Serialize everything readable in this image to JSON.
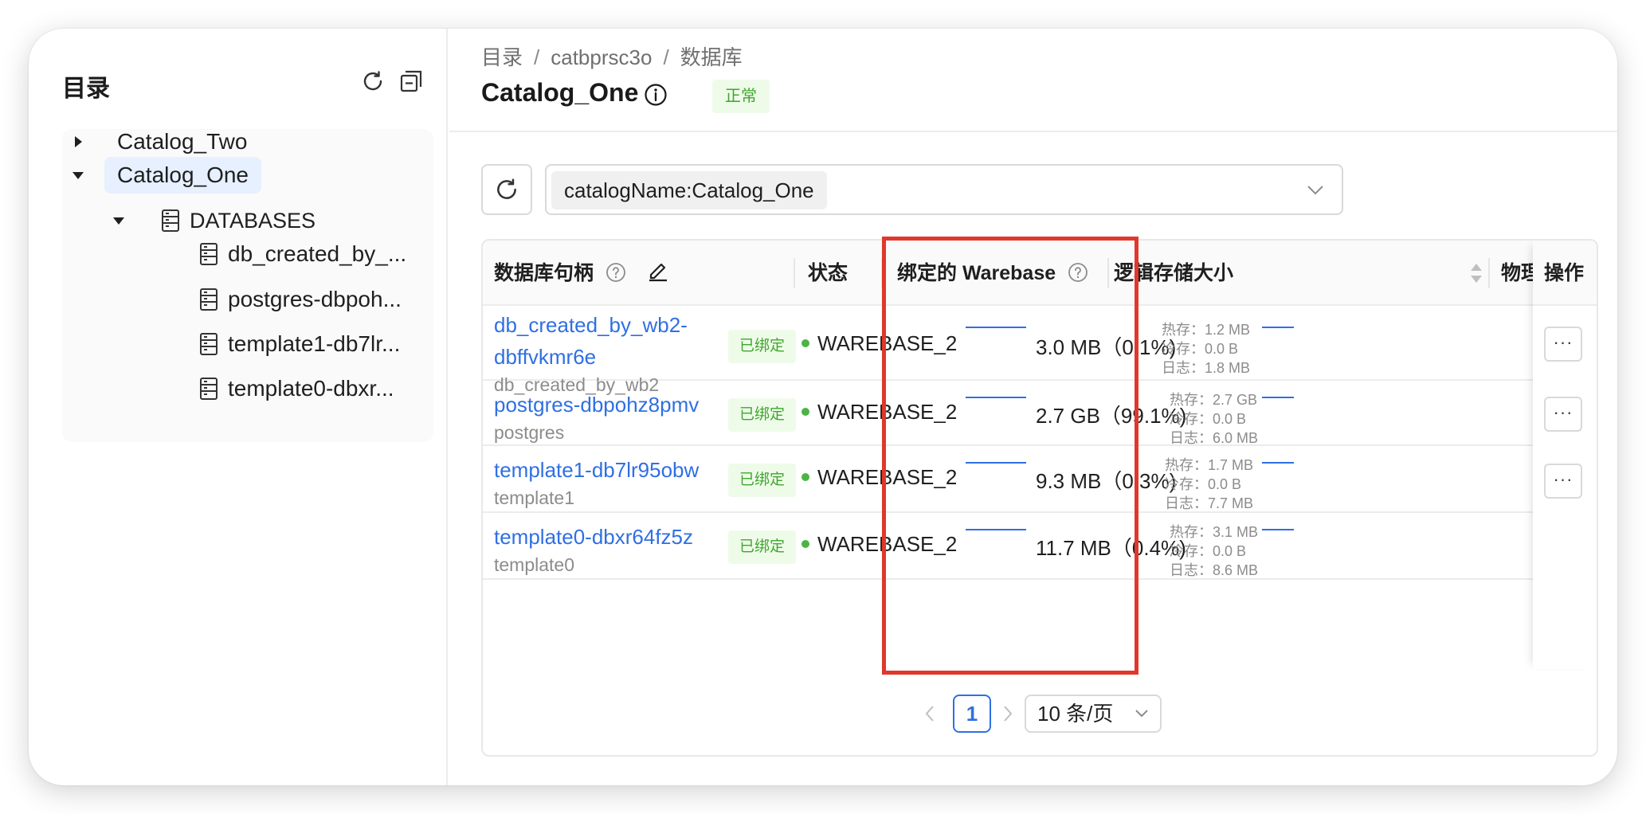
{
  "sidebar": {
    "title": "目录",
    "icons": {
      "refresh": "refresh-icon",
      "collapse": "collapse-all-icon"
    },
    "tree": [
      {
        "label": "Catalog_Two",
        "expanded": false
      },
      {
        "label": "Catalog_One",
        "expanded": true,
        "selected": true
      },
      {
        "label": "DATABASES",
        "expanded": true
      },
      {
        "label": "db_created_by_..."
      },
      {
        "label": "postgres-dbpoh..."
      },
      {
        "label": "template1-db7lr..."
      },
      {
        "label": "template0-dbxr..."
      }
    ]
  },
  "breadcrumb": {
    "items": [
      "目录",
      "catbprsc3o",
      "数据库"
    ],
    "separator": "/"
  },
  "header": {
    "title": "Catalog_One",
    "status": "正常"
  },
  "filter": {
    "tag": "catalogName:Catalog_One"
  },
  "table": {
    "columns": {
      "handle": "数据库句柄",
      "status": "状态",
      "warebase": "绑定的 Warebase",
      "logical_size": "逻辑存储大小",
      "physical": "物理",
      "actions": "操作"
    },
    "rows": [
      {
        "name_line1": "db_created_by_wb2-",
        "name_line2": "dbffvkmr6e",
        "sub": "db_created_by_wb2",
        "status": "已绑定",
        "warebase": "WAREBASE_2",
        "size": "3.0 MB（0.1%)",
        "hot": "热存：1.2 MB",
        "cold": "冷存：0.0 B",
        "log": "日志：1.8 MB",
        "more": "···"
      },
      {
        "name_line1": "postgres-dbpohz8pmv",
        "sub": "postgres",
        "status": "已绑定",
        "warebase": "WAREBASE_2",
        "size": "2.7 GB（99.1%)",
        "hot": "热存：2.7 GB",
        "cold": "冷存：0.0 B",
        "log": "日志：6.0 MB",
        "more": "···"
      },
      {
        "name_line1": "template1-db7lr95obw",
        "sub": "template1",
        "status": "已绑定",
        "warebase": "WAREBASE_2",
        "size": "9.3 MB（0.3%)",
        "hot": "热存：1.7 MB",
        "cold": "冷存：0.0 B",
        "log": "日志：7.7 MB",
        "more": "···"
      },
      {
        "name_line1": "template0-dbxr64fz5z",
        "sub": "template0",
        "status": "已绑定",
        "warebase": "WAREBASE_2",
        "size": "11.7 MB（0.4%)",
        "hot": "热存：3.1 MB",
        "cold": "冷存：0.0 B",
        "log": "日志：8.6 MB"
      }
    ]
  },
  "pagination": {
    "current_page": "1",
    "page_size": "10 条/页"
  },
  "colors": {
    "accent": "#2f6fe4",
    "success": "#3ea72f",
    "highlight": "#e0382b"
  }
}
